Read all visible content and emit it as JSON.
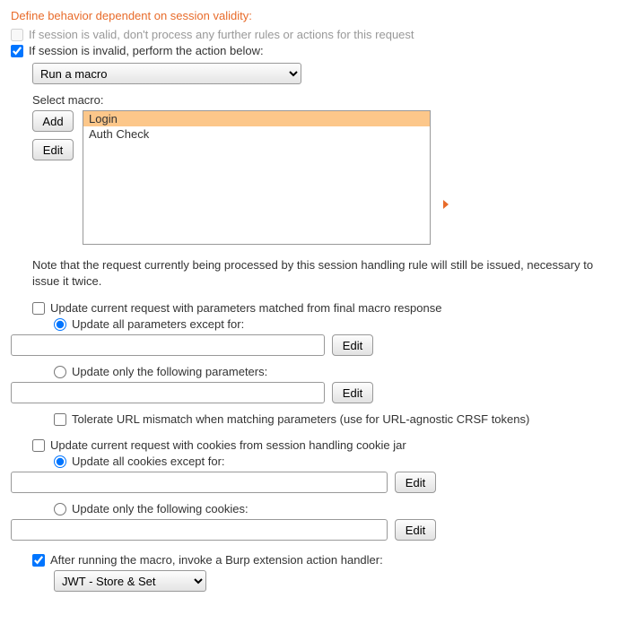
{
  "section_title": "Define behavior dependent on session validity:",
  "valid_session_text": "If session is valid, don't process any further rules or actions for this request",
  "invalid_session_text": "If session is invalid, perform the action below:",
  "action_select": "Run a macro",
  "select_macro_label": "Select macro:",
  "buttons": {
    "add": "Add",
    "edit": "Edit"
  },
  "macros": [
    {
      "name": "Login",
      "selected": true
    },
    {
      "name": "Auth Check",
      "selected": false
    }
  ],
  "note_text": "Note that the request currently being processed by this session handling rule will still be issued, necessary to issue it twice.",
  "update_params": {
    "label": "Update current request with parameters matched from final macro response",
    "all_except": "Update all parameters except for:",
    "only_following": "Update only the following parameters:",
    "tolerate": "Tolerate URL mismatch when matching parameters (use for URL-agnostic CRSF tokens)",
    "all_except_value": "",
    "only_following_value": ""
  },
  "update_cookies": {
    "label": "Update current request with cookies from session handling cookie jar",
    "all_except": "Update all cookies except for:",
    "only_following": "Update only the following cookies:",
    "all_except_value": "",
    "only_following_value": ""
  },
  "invoke_ext": {
    "label": "After running the macro, invoke a Burp extension action handler:",
    "selected": "JWT - Store & Set"
  }
}
